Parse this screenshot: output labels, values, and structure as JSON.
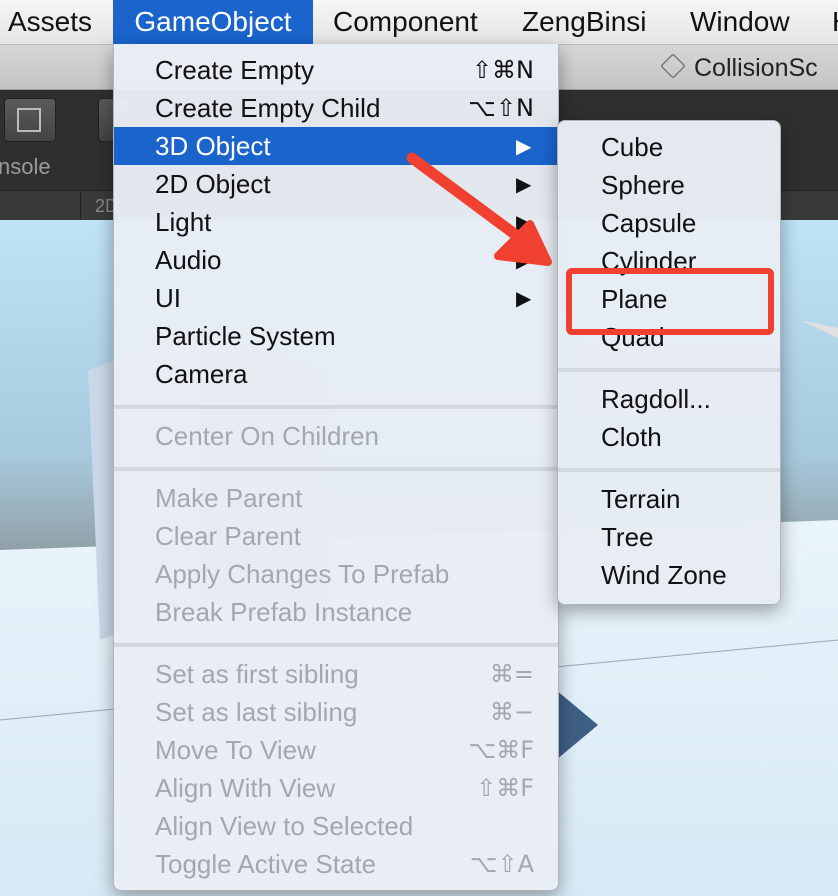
{
  "menubar": {
    "items": [
      {
        "label": "Assets",
        "active": false
      },
      {
        "label": "GameObject",
        "active": true
      },
      {
        "label": "Component",
        "active": false
      },
      {
        "label": "ZengBinsi",
        "active": false
      },
      {
        "label": "Window",
        "active": false
      },
      {
        "label": "H",
        "active": false
      }
    ]
  },
  "editor": {
    "scene_tab_label": "CollisionSc",
    "console_label": "nsole",
    "scene_mode_label": "2D"
  },
  "gameobject_menu": {
    "items": [
      {
        "label": "Create Empty",
        "shortcut": "⇧⌘N",
        "enabled": true
      },
      {
        "label": "Create Empty Child",
        "shortcut": "⌥⇧N",
        "enabled": true
      },
      {
        "label": "3D Object",
        "submenu": true,
        "enabled": true,
        "highlighted": true
      },
      {
        "label": "2D Object",
        "submenu": true,
        "enabled": true
      },
      {
        "label": "Light",
        "submenu": true,
        "enabled": true
      },
      {
        "label": "Audio",
        "submenu": true,
        "enabled": true
      },
      {
        "label": "UI",
        "submenu": true,
        "enabled": true
      },
      {
        "label": "Particle System",
        "enabled": true
      },
      {
        "label": "Camera",
        "enabled": true
      },
      {
        "label": "Center On Children",
        "enabled": false
      },
      {
        "label": "Make Parent",
        "enabled": false
      },
      {
        "label": "Clear Parent",
        "enabled": false
      },
      {
        "label": "Apply Changes To Prefab",
        "enabled": false
      },
      {
        "label": "Break Prefab Instance",
        "enabled": false
      },
      {
        "label": "Set as first sibling",
        "shortcut": "⌘=",
        "enabled": false
      },
      {
        "label": "Set as last sibling",
        "shortcut": "⌘−",
        "enabled": false
      },
      {
        "label": "Move To View",
        "shortcut": "⌥⌘F",
        "enabled": false
      },
      {
        "label": "Align With View",
        "shortcut": "⇧⌘F",
        "enabled": false
      },
      {
        "label": "Align View to Selected",
        "enabled": false
      },
      {
        "label": "Toggle Active State",
        "shortcut": "⌥⇧A",
        "enabled": false
      }
    ],
    "submenu_arrow": "▶"
  },
  "object3d_submenu": {
    "items": [
      {
        "label": "Cube"
      },
      {
        "label": "Sphere"
      },
      {
        "label": "Capsule"
      },
      {
        "label": "Cylinder"
      },
      {
        "label": "Plane",
        "annotated": true
      },
      {
        "label": "Quad"
      },
      {
        "label": "Ragdoll..."
      },
      {
        "label": "Cloth"
      },
      {
        "label": "Terrain"
      },
      {
        "label": "Tree"
      },
      {
        "label": "Wind Zone"
      }
    ]
  },
  "annotation": {
    "color": "#f04030",
    "target": "Plane"
  },
  "colors": {
    "menu_highlight": "#1a64cc",
    "disabled_text": "#a4a8ae",
    "menu_background": "#e8edf4"
  }
}
